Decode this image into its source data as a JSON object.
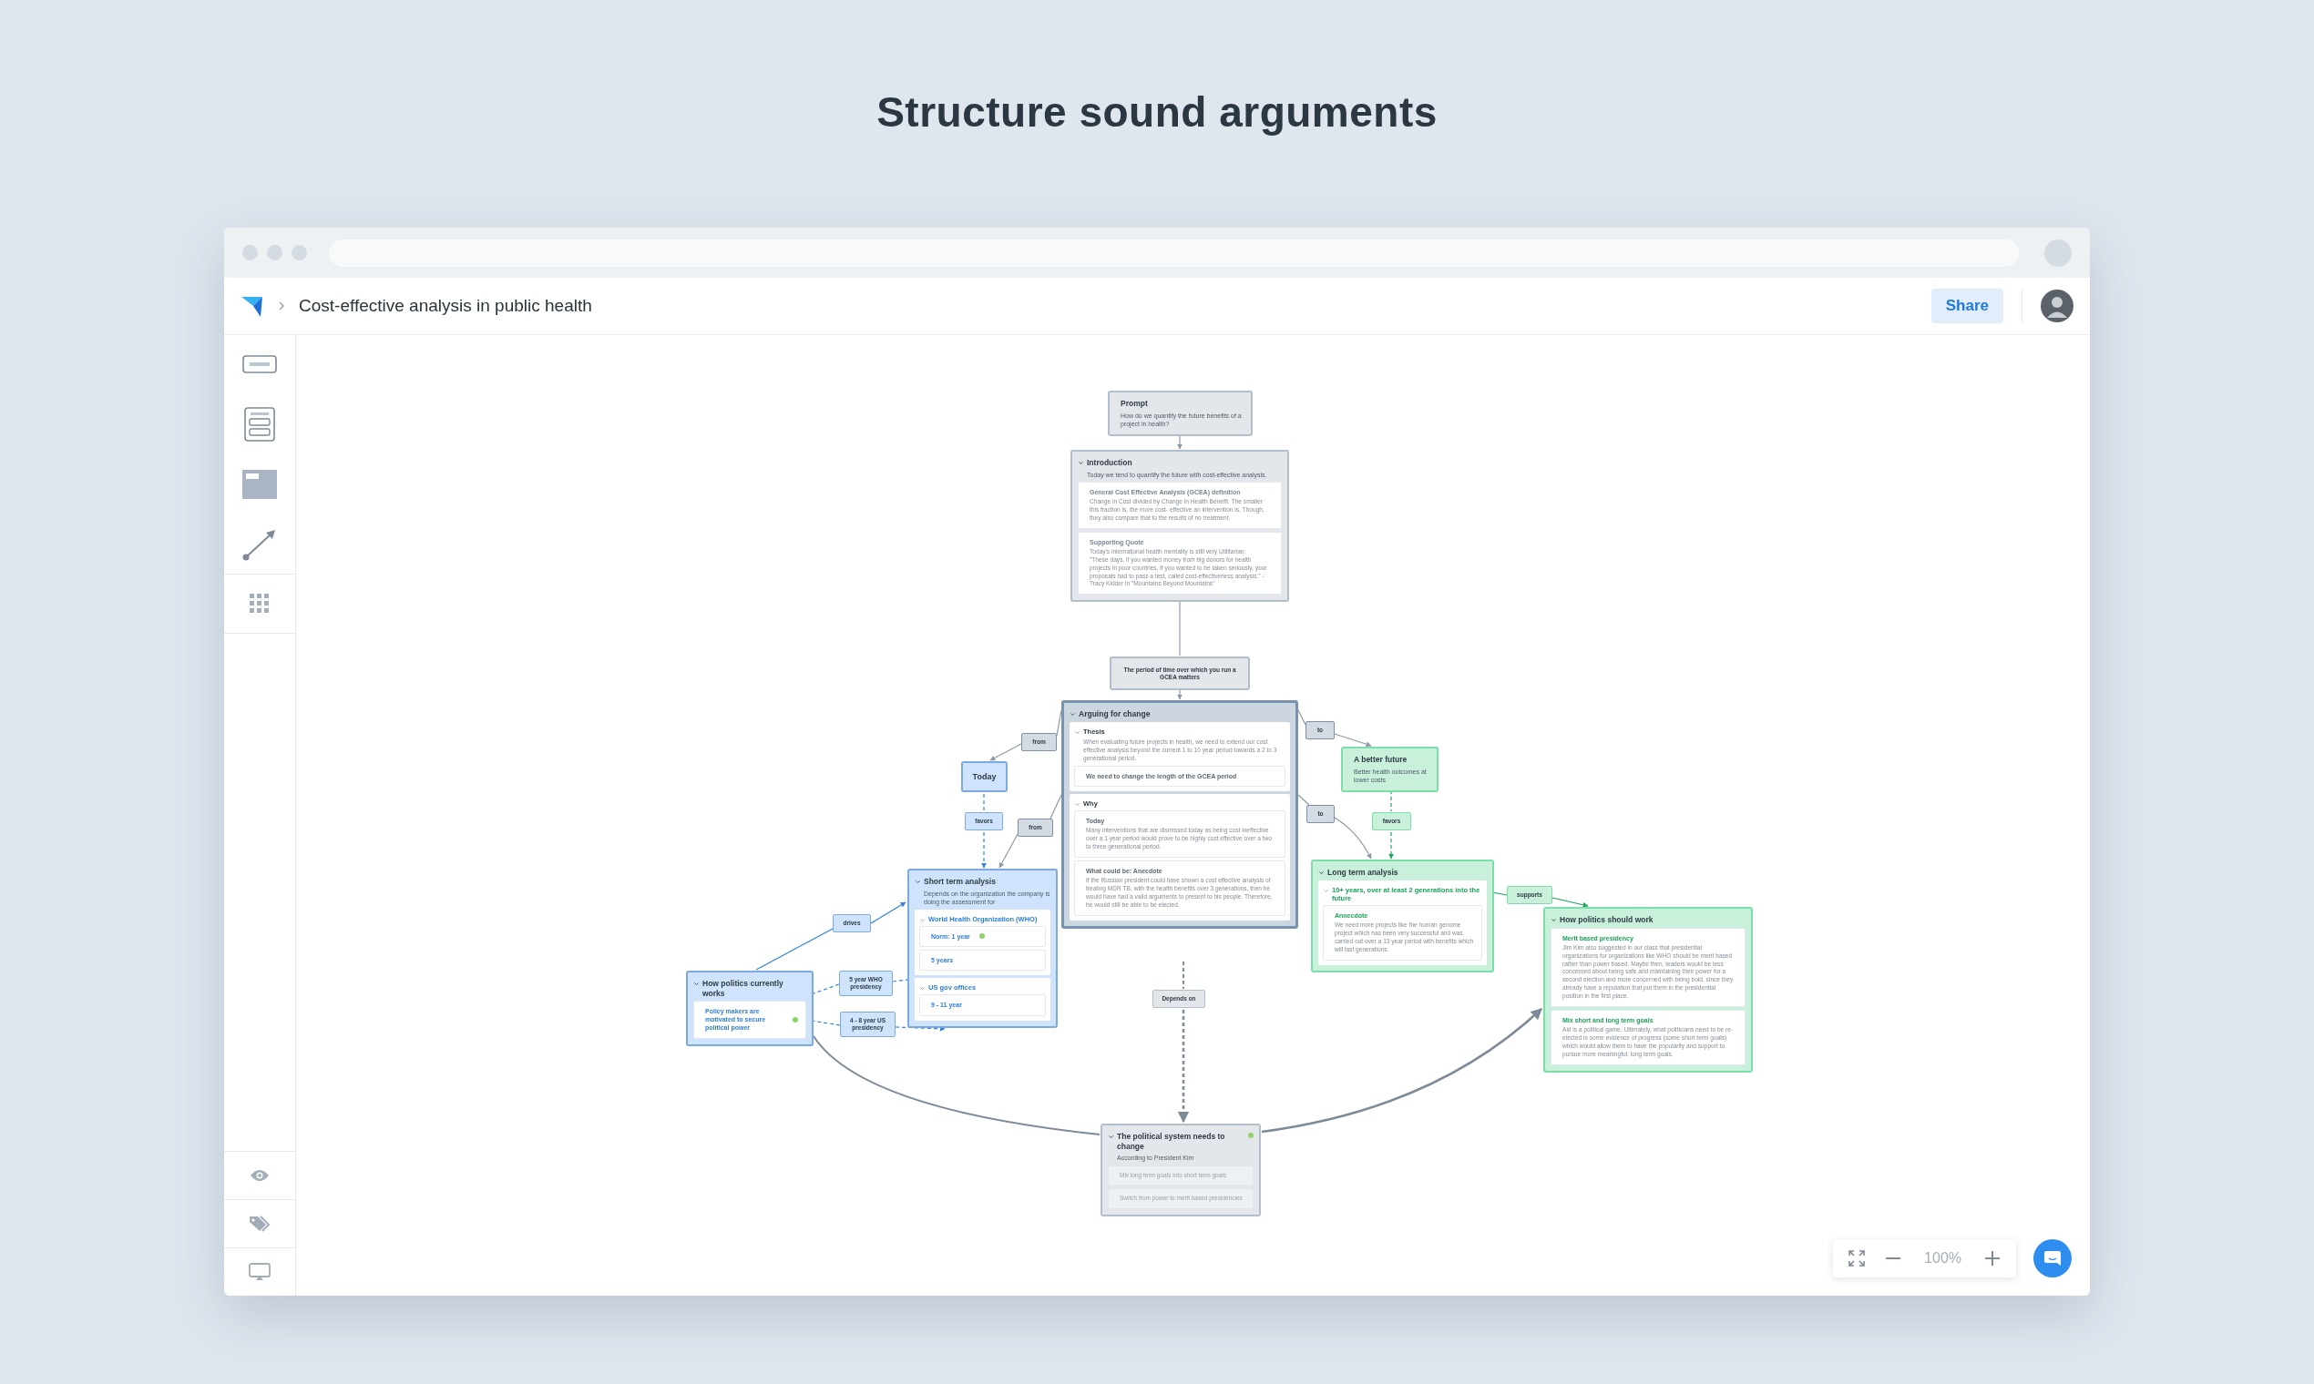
{
  "page_title": "Structure sound arguments",
  "header": {
    "document_title": "Cost-effective analysis in public health",
    "share_label": "Share"
  },
  "nodes": [
    {
      "kind": "note",
      "color": "#e3e7ec",
      "title": "Prompt",
      "text": "How do we quantify the future benefits of a project in health?"
    },
    {
      "kind": "group",
      "color": "#e3e7ec",
      "expanded": true,
      "title": "Introduction",
      "text": "Today we tend to quantify the future with cost-effective analysis.",
      "children": [
        {
          "kind": "card",
          "title": "General Cost Effective Analysis (GCEA) definition",
          "text": "Change in Cost divided by Change in Health Benefit. The smaller this fraction is, the more cost- effective an intervention is. Though, they also compare that to the results of no treatment."
        },
        {
          "kind": "card",
          "title": "Supporting Quote",
          "text": "Today's international health mentality is still very Utilitarian:\n\"These days, if you wanted money from big donors for health projects in poor countries, if you wanted to be taken seriously, your proposals had to pass a test, called cost-effectiveness analysis.\" -Tracy Kidder in \"Mountains Beyond Mountains\""
        }
      ]
    },
    {
      "kind": "statement",
      "color": "#e3e7ec",
      "title": "The period of time over which you run a GCEA matters"
    },
    {
      "kind": "group",
      "color": "#ccd6e1",
      "expanded": true,
      "title": "Arguing for change",
      "children": [
        {
          "kind": "section",
          "expanded": true,
          "title": "Thesis",
          "text": "When evaluating future projects in health, we need to extend our cost effective analysis beyond the current 1 to 10 year period towards a 2 to 3 generational period.",
          "children": [
            {
              "kind": "card",
              "title": "We need to change the length of the GCEA period"
            }
          ]
        },
        {
          "kind": "section",
          "expanded": true,
          "title": "Why",
          "children": [
            {
              "kind": "card",
              "title": "Today",
              "text": "Many interventions that are dismissed today as being cost ineffective over a 1 year period would prove to be highly cost effective over a two to three generational period."
            },
            {
              "kind": "card",
              "title": "What could be: Anecdote",
              "text": "If the Russian president could have shown a cost effective analysis of treating MDR TB, with the health benefits over 3 generations, then he would have had a valid arguments to present to his people. Therefore, he would still be able to be elected."
            }
          ]
        }
      ]
    },
    {
      "kind": "statement",
      "color": "#cfe4fc",
      "title": "Today"
    },
    {
      "kind": "note",
      "color": "#c8f0da",
      "title": "A better future",
      "text": "Better health outcomes at lower costs"
    },
    {
      "kind": "group",
      "color": "#cfe4fc",
      "expanded": true,
      "title": "Short term analysis",
      "text": "Depends on the organization the company is doing the assessment for",
      "children": [
        {
          "kind": "section",
          "expanded": true,
          "title": "World Health Organization (WHO)",
          "children": [
            {
              "kind": "card",
              "title": "Norm: 1 year",
              "dot": true
            },
            {
              "kind": "card",
              "title": "5 years",
              "dot": false
            }
          ]
        },
        {
          "kind": "section",
          "expanded": true,
          "title": "US gov offices",
          "children": [
            {
              "kind": "card",
              "title": "9 - 11 year",
              "dot": false
            }
          ]
        }
      ]
    },
    {
      "kind": "group",
      "color": "#cfe4fc",
      "expanded": true,
      "title": "How politics currently works",
      "children": [
        {
          "kind": "card",
          "title": "Policy makers are motivated to secure political power",
          "dot": true
        }
      ]
    },
    {
      "kind": "group",
      "color": "#c8f0da",
      "expanded": true,
      "title": "Long term analysis",
      "children": [
        {
          "kind": "section",
          "expanded": true,
          "title": "10+ years, over at least 2 generations into the future",
          "children": [
            {
              "kind": "card",
              "title": "Annecdote",
              "text": "We need more projects like the human genome project which has been very successful and was carried out over a 13 year period with benefits which will last generations."
            }
          ]
        }
      ]
    },
    {
      "kind": "group",
      "color": "#c8f0da",
      "expanded": true,
      "title": "How politics should work",
      "children": [
        {
          "kind": "card",
          "title": "Merit based presidency",
          "text": "Jim Kim also suggested in our class that presidential organizations for organizations like WHO should be merit based rather than power based. Maybe then, leaders would be less concerned about being safe and maintaining their power for a second election and more concerned with being bold, since they already have a reputation that put them in the presidential position in the first place."
        },
        {
          "kind": "card",
          "title": "Mix short and long term goals",
          "text": "Aid is a political game. Ultimately, what politicians need to be re-elected is some evidence of progress (some short term goals) which would allow them to have the popularity and support to pursue more meaningful, long term goals."
        }
      ]
    },
    {
      "kind": "group",
      "color": "#e3e7ec",
      "expanded": true,
      "dot": true,
      "title": "The political system needs to change",
      "text": "According to President Kim",
      "children": [
        {
          "kind": "card",
          "text": "Mix long term goals into short term goals"
        },
        {
          "kind": "card",
          "text": "Switch from power to merit based presidencies"
        }
      ]
    }
  ],
  "edge_labels": [
    {
      "text": "from",
      "color": "#d3dae2"
    },
    {
      "text": "to",
      "color": "#d3dae2"
    },
    {
      "text": "favors",
      "color": "#cfe4fc"
    },
    {
      "text": "from",
      "color": "#d3dae2"
    },
    {
      "text": "to",
      "color": "#d3dae2"
    },
    {
      "text": "favors",
      "color": "#c8f0da"
    },
    {
      "text": "drives",
      "color": "#cfe4fc"
    },
    {
      "text": "supports",
      "color": "#c8f0da"
    },
    {
      "text": "5 year WHO presidency",
      "color": "#cfe4fc"
    },
    {
      "text": "4 - 8 year US presidency",
      "color": "#cfe4fc"
    },
    {
      "text": "Depends on",
      "color": "#e3e7ec"
    }
  ],
  "zoom": {
    "reading": "100%"
  }
}
